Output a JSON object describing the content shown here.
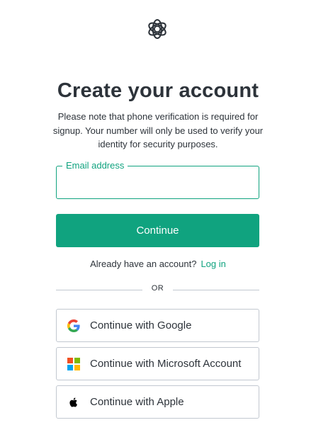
{
  "logo": {
    "icon": "openai-logo-icon"
  },
  "title": "Create your account",
  "notice": "Please note that phone verification is required for signup. Your number will only be used to verify your identity for security purposes.",
  "email": {
    "label": "Email address",
    "value": "",
    "placeholder": ""
  },
  "continue_label": "Continue",
  "login": {
    "prompt": "Already have an account?",
    "link": "Log in"
  },
  "divider_text": "OR",
  "social": {
    "google": {
      "label": "Continue with Google",
      "icon": "google-icon"
    },
    "microsoft": {
      "label": "Continue with Microsoft Account",
      "icon": "microsoft-icon"
    },
    "apple": {
      "label": "Continue with Apple",
      "icon": "apple-icon"
    }
  },
  "colors": {
    "accent": "#10a37f",
    "text": "#2d333a",
    "border": "#c2c8d0",
    "google_blue": "#4285F4",
    "google_red": "#EA4335",
    "google_yellow": "#FBBC05",
    "google_green": "#34A853",
    "ms_red": "#F25022",
    "ms_green": "#7FBA00",
    "ms_blue": "#00A4EF",
    "ms_yellow": "#FFB900"
  }
}
